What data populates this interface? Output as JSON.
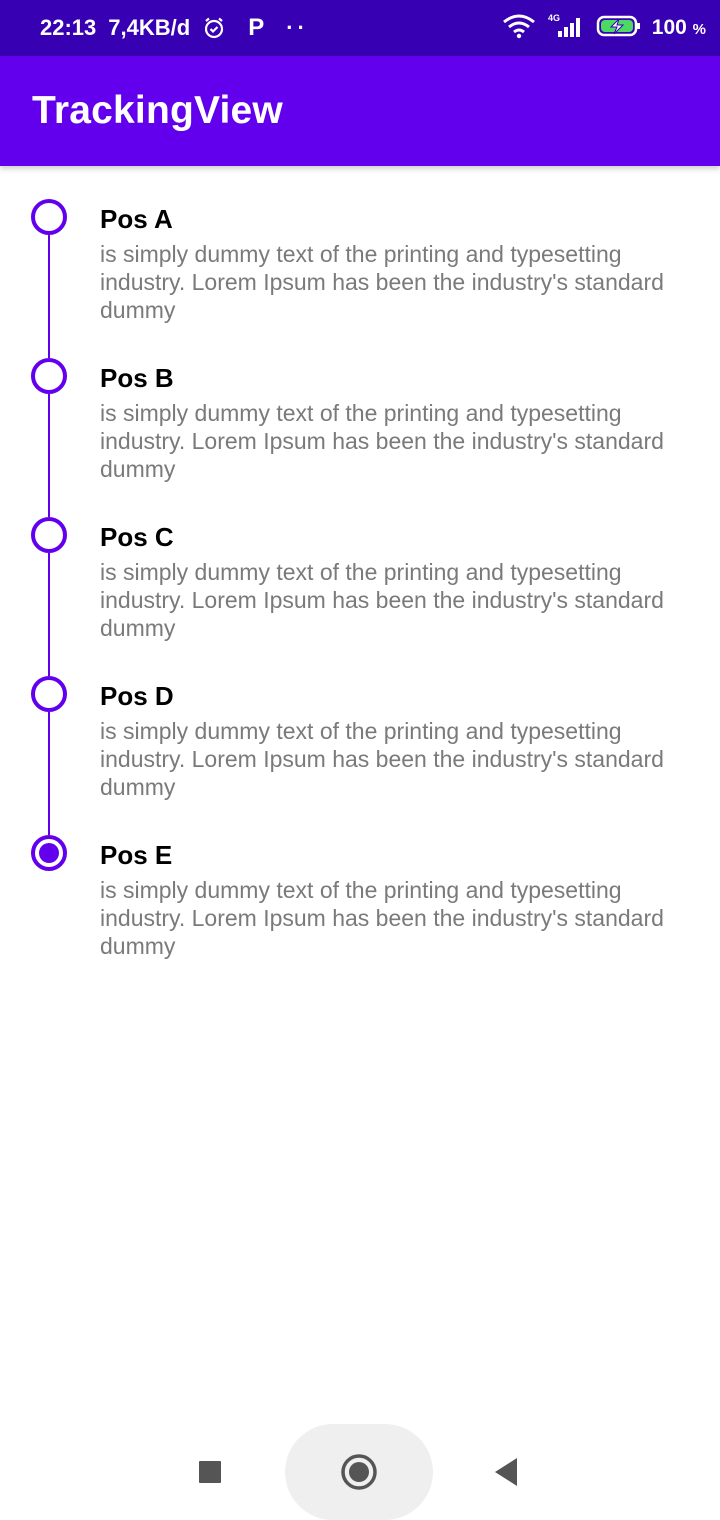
{
  "status_bar": {
    "time": "22:13",
    "speed": "7,4KB/d",
    "p_icon_glyph": "P",
    "dots": "··",
    "network": "4G",
    "battery_percent": "100",
    "battery_unit": "%",
    "icons": [
      "alarm-icon",
      "wifi-icon",
      "signal-icon",
      "battery-charging-icon"
    ]
  },
  "app_bar": {
    "title": "TrackingView",
    "color": "#6200ee"
  },
  "timeline": {
    "accent_color": "#6200ee",
    "items": [
      {
        "title": "Pos A",
        "description": "is simply dummy text of the printing and typesetting industry. Lorem Ipsum has been the industry's standard dummy",
        "active": false
      },
      {
        "title": "Pos B",
        "description": "is simply dummy text of the printing and typesetting industry. Lorem Ipsum has been the industry's standard dummy",
        "active": false
      },
      {
        "title": "Pos C",
        "description": "is simply dummy text of the printing and typesetting industry. Lorem Ipsum has been the industry's standard dummy",
        "active": false
      },
      {
        "title": "Pos D",
        "description": "is simply dummy text of the printing and typesetting industry. Lorem Ipsum has been the industry's standard dummy",
        "active": false
      },
      {
        "title": "Pos E",
        "description": "is simply dummy text of the printing and typesetting industry. Lorem Ipsum has been the industry's standard dummy",
        "active": true
      }
    ]
  },
  "nav_bar": {
    "buttons": [
      "recent-apps-icon",
      "home-icon",
      "back-icon"
    ]
  }
}
